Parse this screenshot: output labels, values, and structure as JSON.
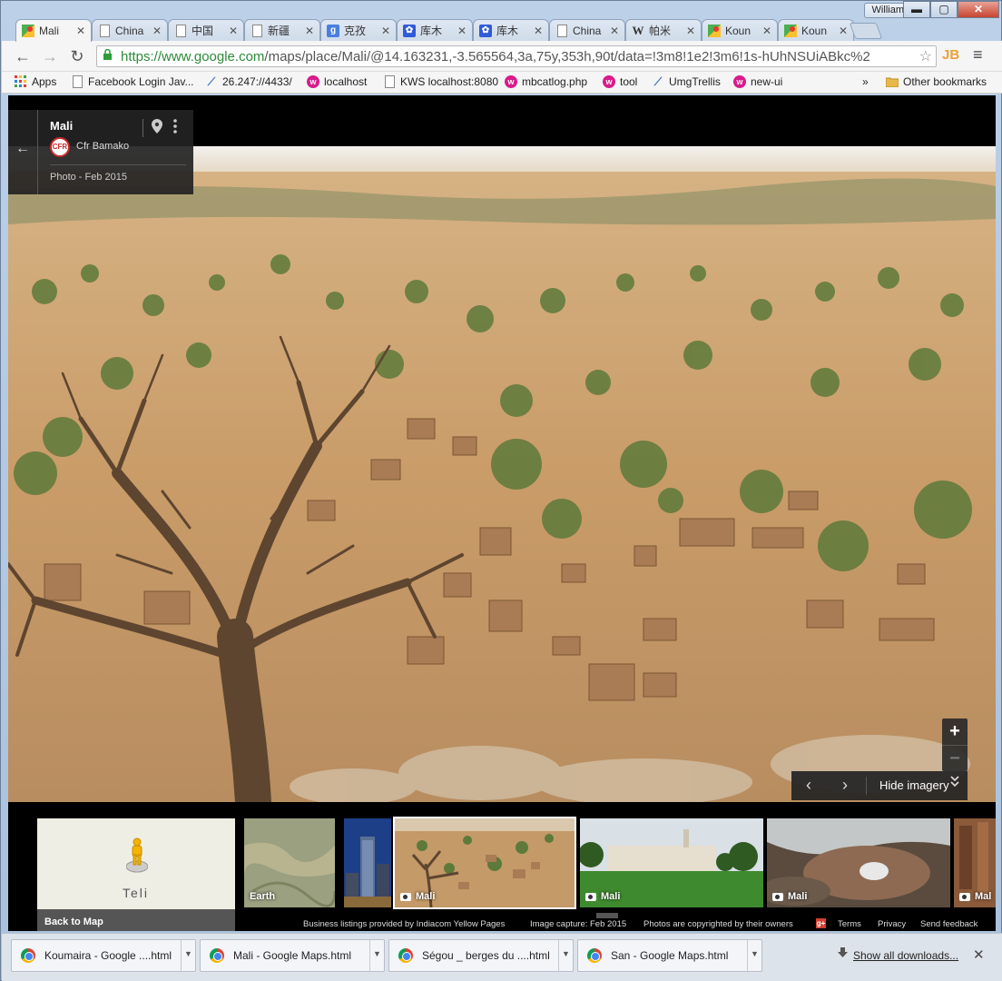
{
  "window": {
    "user": "William",
    "controls": {
      "minimize": "▬",
      "maximize": "▢",
      "close": "✕"
    }
  },
  "tabs": [
    {
      "label": "Mali",
      "icon": "google-maps-icon",
      "active": true
    },
    {
      "label": "China",
      "icon": "page-icon"
    },
    {
      "label": "中国",
      "icon": "page-icon"
    },
    {
      "label": "新疆",
      "icon": "page-icon"
    },
    {
      "label": "克孜",
      "icon": "google-icon"
    },
    {
      "label": "库木",
      "icon": "baidu-icon"
    },
    {
      "label": "库木",
      "icon": "baidu-icon"
    },
    {
      "label": "China",
      "icon": "page-icon"
    },
    {
      "label": "帕米",
      "icon": "wikipedia-icon"
    },
    {
      "label": "Koun",
      "icon": "google-maps-icon"
    },
    {
      "label": "Koun",
      "icon": "google-maps-icon"
    }
  ],
  "toolbar": {
    "url_host": "https://www.google.com",
    "url_rest": "/maps/place/Mali/@14.163231,-3.565564,3a,75y,353h,90t/data=!3m8!1e2!3m6!1s-hUhNSUiABkc%2",
    "ext_label": "JB"
  },
  "bookmarks": [
    {
      "label": "Apps",
      "icon": "apps-grid-icon"
    },
    {
      "label": "Facebook Login Jav...",
      "icon": "page-icon"
    },
    {
      "label": "26.247://4433/",
      "icon": "trellis-icon"
    },
    {
      "label": "localhost",
      "icon": "magenta-circle-icon"
    },
    {
      "label": "KWS localhost:8080",
      "icon": "page-icon"
    },
    {
      "label": "mbcatlog.php",
      "icon": "magenta-circle-icon"
    },
    {
      "label": "tool",
      "icon": "magenta-circle-icon"
    },
    {
      "label": "UmgTrellis",
      "icon": "trellis-icon"
    },
    {
      "label": "new-ui",
      "icon": "magenta-circle-icon"
    }
  ],
  "bookmarks_overflow": "»",
  "bookmarks_other": "Other bookmarks",
  "infocard": {
    "title": "Mali",
    "author_logo": "CFR",
    "author": "Cfr Bamako",
    "photo_date": "Photo - Feb 2015"
  },
  "zoom": {
    "in": "+",
    "out": "−"
  },
  "imagery_nav": {
    "prev": "‹",
    "next": "›",
    "hide_label": "Hide imagery"
  },
  "minimap": {
    "place_label": "Teli",
    "back_label": "Back to Map"
  },
  "thumbnails": [
    {
      "label": "Earth",
      "camera": false
    },
    {
      "label": "",
      "camera": false
    },
    {
      "label": "Mali",
      "camera": true,
      "selected": true
    },
    {
      "label": "Mali",
      "camera": true
    },
    {
      "label": "Mali",
      "camera": true
    },
    {
      "label": "Mal",
      "camera": true
    }
  ],
  "footer": {
    "listings": "Business listings provided by Indiacom Yellow Pages",
    "capture": "Image capture: Feb 2015",
    "copyright": "Photos are copyrighted by their owners",
    "gplus": "g+",
    "terms": "Terms",
    "privacy": "Privacy",
    "feedback": "Send feedback"
  },
  "downloads": [
    {
      "name": "Koumaira - Google ....html"
    },
    {
      "name": "Mali - Google Maps.html"
    },
    {
      "name": "Ségou _ berges du ....html"
    },
    {
      "name": "San - Google Maps.html"
    }
  ],
  "download_bar": {
    "show_all": "Show all downloads...",
    "close": "✕"
  }
}
